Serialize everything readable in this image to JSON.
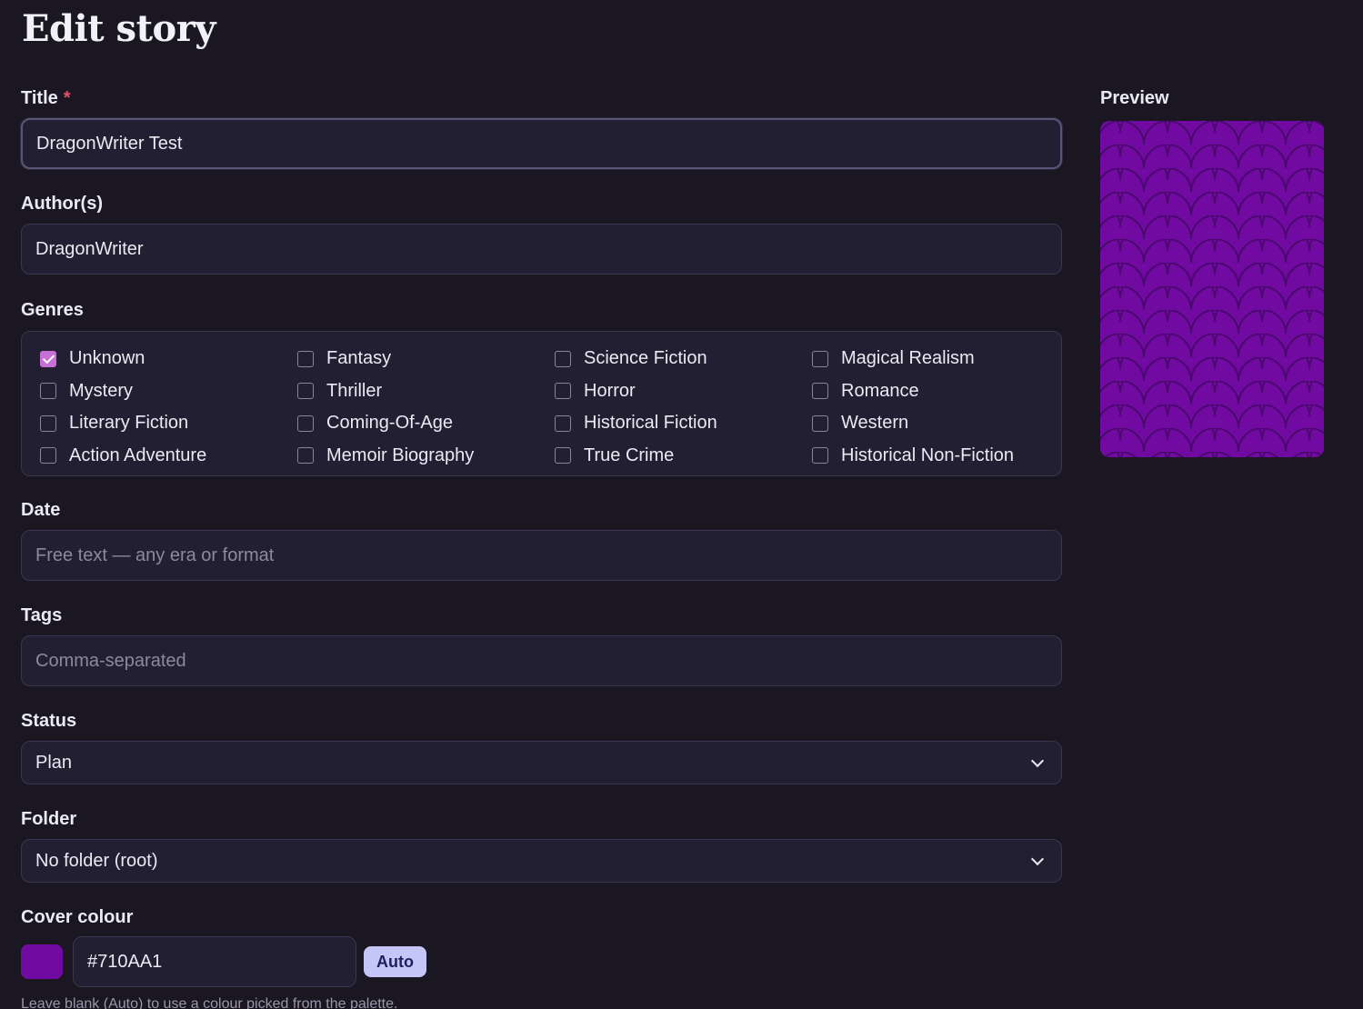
{
  "page": {
    "title": "Edit story"
  },
  "form": {
    "title": {
      "label": "Title",
      "required_mark": "*",
      "value": "DragonWriter Test"
    },
    "authors": {
      "label": "Author(s)",
      "value": "DragonWriter"
    },
    "genres": {
      "label": "Genres",
      "items": [
        {
          "label": "Unknown",
          "checked": true
        },
        {
          "label": "Fantasy",
          "checked": false
        },
        {
          "label": "Science Fiction",
          "checked": false
        },
        {
          "label": "Magical Realism",
          "checked": false
        },
        {
          "label": "Mystery",
          "checked": false
        },
        {
          "label": "Thriller",
          "checked": false
        },
        {
          "label": "Horror",
          "checked": false
        },
        {
          "label": "Romance",
          "checked": false
        },
        {
          "label": "Literary Fiction",
          "checked": false
        },
        {
          "label": "Coming-Of-Age",
          "checked": false
        },
        {
          "label": "Historical Fiction",
          "checked": false
        },
        {
          "label": "Western",
          "checked": false
        },
        {
          "label": "Action Adventure",
          "checked": false
        },
        {
          "label": "Memoir Biography",
          "checked": false
        },
        {
          "label": "True Crime",
          "checked": false
        },
        {
          "label": "Historical Non-Fiction",
          "checked": false
        }
      ]
    },
    "date": {
      "label": "Date",
      "value": "",
      "placeholder": "Free text — any era or format"
    },
    "tags": {
      "label": "Tags",
      "value": "",
      "placeholder": "Comma-separated"
    },
    "status": {
      "label": "Status",
      "selected": "Plan"
    },
    "folder": {
      "label": "Folder",
      "selected": "No folder (root)"
    },
    "cover_colour": {
      "label": "Cover colour",
      "value": "#710AA1",
      "auto_label": "Auto",
      "hint": "Leave blank (Auto) to use a colour picked from the palette."
    }
  },
  "preview": {
    "label": "Preview"
  },
  "colors": {
    "background": "#1a1722",
    "cover": "#710AA1",
    "scale_line": "#4a0870",
    "checkbox_checked": "#c86fd6",
    "auto_button": "#c4c6f8"
  }
}
